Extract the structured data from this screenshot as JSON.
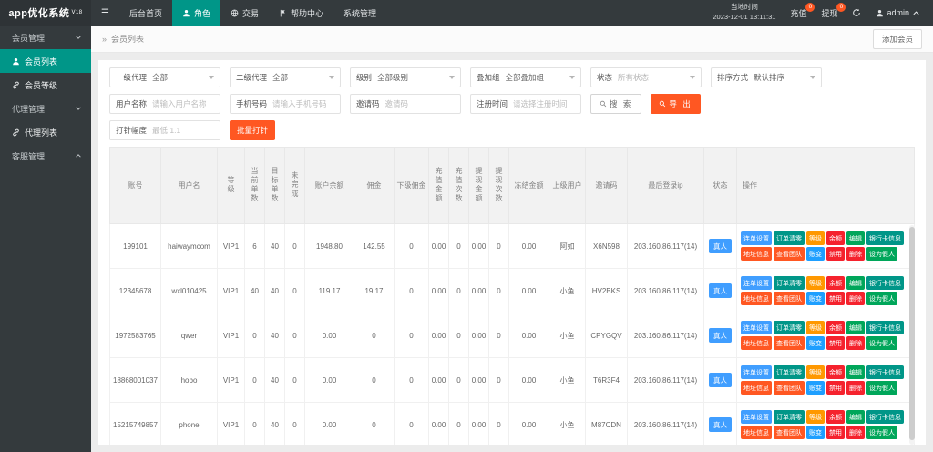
{
  "colors": {
    "accent": "#009688",
    "badge": "#ff5722",
    "export_button": "#ff5722",
    "status_badge": "#409eff"
  },
  "icons": {
    "hamburger": "☰",
    "breadcrumb_arrow": "»"
  },
  "topbar": {
    "logo": "app优化系统",
    "logo_version": "V18",
    "nav": [
      {
        "label": "后台首页"
      },
      {
        "label": "角色",
        "icon": "user-icon",
        "active": true
      },
      {
        "label": "交易",
        "icon": "exchange-icon"
      },
      {
        "label": "帮助中心",
        "icon": "flag-icon"
      },
      {
        "label": "系统管理"
      }
    ],
    "local_time_label": "当地时间",
    "local_time_value": "2023-12-01 13:11:31",
    "recharge_label": "充值",
    "recharge_badge": "0",
    "withdraw_label": "提现",
    "withdraw_badge": "0",
    "username": "admin"
  },
  "sidebar": {
    "items": [
      {
        "label": "会员管理",
        "type": "group",
        "chevron": "down"
      },
      {
        "label": "会员列表",
        "type": "link",
        "icon": "user-icon",
        "active": true
      },
      {
        "label": "会员等级",
        "type": "link",
        "icon": "link-icon"
      },
      {
        "label": "代理管理",
        "type": "group",
        "chevron": "down"
      },
      {
        "label": "代理列表",
        "type": "link",
        "icon": "link-icon"
      },
      {
        "label": "客服管理",
        "type": "group",
        "chevron": "up"
      }
    ]
  },
  "breadcrumb": {
    "title": "会员列表",
    "add_button_label": "添加会员"
  },
  "filters": {
    "selects": [
      {
        "label": "一级代理",
        "value": "全部"
      },
      {
        "label": "二级代理",
        "value": "全部"
      },
      {
        "label": "级别",
        "value": "全部级别"
      },
      {
        "label": "叠加组",
        "value": "全部叠加组"
      },
      {
        "label": "状态",
        "value": "所有状态",
        "muted": true
      },
      {
        "label": "排序方式",
        "value": "默认排序"
      }
    ],
    "inputs": [
      {
        "label": "用户名称",
        "placeholder": "请输入用户名称"
      },
      {
        "label": "手机号码",
        "placeholder": "请输入手机号码"
      },
      {
        "label": "邀请码",
        "placeholder": "邀请码"
      },
      {
        "label": "注册时间",
        "placeholder": "请选择注册时间"
      }
    ],
    "search_label": "搜 索",
    "export_label": "导 出",
    "inject": {
      "label": "打针幅度",
      "placeholder": "最低 1.1",
      "button_label": "批量打针"
    }
  },
  "table": {
    "headers": [
      {
        "label": "账号"
      },
      {
        "label": "用户名"
      },
      {
        "label": "等级",
        "vertical": true
      },
      {
        "label": "当前单数",
        "vertical": true
      },
      {
        "label": "目标单数",
        "vertical": true
      },
      {
        "label": "未完成",
        "vertical": true
      },
      {
        "label": "账户余额"
      },
      {
        "label": "佣金"
      },
      {
        "label": "下级佣金"
      },
      {
        "label": "充值金额",
        "vertical": true
      },
      {
        "label": "充值次数",
        "vertical": true
      },
      {
        "label": "提现金额",
        "vertical": true
      },
      {
        "label": "提现次数",
        "vertical": true
      },
      {
        "label": "冻结金额"
      },
      {
        "label": "上级用户"
      },
      {
        "label": "邀请码"
      },
      {
        "label": "最后登录ip"
      },
      {
        "label": "状态"
      },
      {
        "label": "操作"
      }
    ],
    "rows": [
      {
        "account": "199101",
        "username": "haiwaymcom",
        "level": "VIP1",
        "current_orders": "6",
        "target_orders": "40",
        "unfinished": "0",
        "balance": "1948.80",
        "commission": "142.55",
        "sub_commission": "0",
        "recharge_amount": "0.00",
        "recharge_count": "0",
        "withdraw_amount": "0.00",
        "withdraw_count": "0",
        "frozen_amount": "0.00",
        "parent_user": "阿如",
        "invite_code": "X6N598",
        "last_login_ip": "203.160.86.117(14)",
        "status": "真人"
      },
      {
        "account": "12345678",
        "username": "wxl010425",
        "level": "VIP1",
        "current_orders": "40",
        "target_orders": "40",
        "unfinished": "0",
        "balance": "119.17",
        "commission": "19.17",
        "sub_commission": "0",
        "recharge_amount": "0.00",
        "recharge_count": "0",
        "withdraw_amount": "0.00",
        "withdraw_count": "0",
        "frozen_amount": "0.00",
        "parent_user": "小鱼",
        "invite_code": "HV2BKS",
        "last_login_ip": "203.160.86.117(14)",
        "status": "真人"
      },
      {
        "account": "1972583765",
        "username": "qwer",
        "level": "VIP1",
        "current_orders": "0",
        "target_orders": "40",
        "unfinished": "0",
        "balance": "0.00",
        "commission": "0",
        "sub_commission": "0",
        "recharge_amount": "0.00",
        "recharge_count": "0",
        "withdraw_amount": "0.00",
        "withdraw_count": "0",
        "frozen_amount": "0.00",
        "parent_user": "小鱼",
        "invite_code": "CPYGQV",
        "last_login_ip": "203.160.86.117(14)",
        "status": "真人"
      },
      {
        "account": "18868001037",
        "username": "hobo",
        "level": "VIP1",
        "current_orders": "0",
        "target_orders": "40",
        "unfinished": "0",
        "balance": "0.00",
        "commission": "0",
        "sub_commission": "0",
        "recharge_amount": "0.00",
        "recharge_count": "0",
        "withdraw_amount": "0.00",
        "withdraw_count": "0",
        "frozen_amount": "0.00",
        "parent_user": "小鱼",
        "invite_code": "T6R3F4",
        "last_login_ip": "203.160.86.117(14)",
        "status": "真人"
      },
      {
        "account": "15215749857",
        "username": "phone",
        "level": "VIP1",
        "current_orders": "0",
        "target_orders": "40",
        "unfinished": "0",
        "balance": "0.00",
        "commission": "0",
        "sub_commission": "0",
        "recharge_amount": "0.00",
        "recharge_count": "0",
        "withdraw_amount": "0.00",
        "withdraw_count": "0",
        "frozen_amount": "0.00",
        "parent_user": "小鱼",
        "invite_code": "M87CDN",
        "last_login_ip": "203.160.86.117(14)",
        "status": "真人"
      }
    ],
    "status_color": "#409eff",
    "actions_row1": [
      {
        "label": "连单设置",
        "color": "#409eff"
      },
      {
        "label": "订单清零",
        "color": "#009688"
      },
      {
        "label": "等级",
        "color": "#ff9800"
      },
      {
        "label": "余额",
        "color": "#f5222d"
      },
      {
        "label": "编辑",
        "color": "#00a65a"
      },
      {
        "label": "银行卡信息",
        "color": "#009688"
      }
    ],
    "actions_row2": [
      {
        "label": "地址信息",
        "color": "#ff5722"
      },
      {
        "label": "查看团队",
        "color": "#ff5722"
      },
      {
        "label": "账变",
        "color": "#1e9fff"
      },
      {
        "label": "禁用",
        "color": "#f5222d"
      },
      {
        "label": "删除",
        "color": "#f5222d"
      },
      {
        "label": "设为假人",
        "color": "#00a65a"
      }
    ]
  }
}
